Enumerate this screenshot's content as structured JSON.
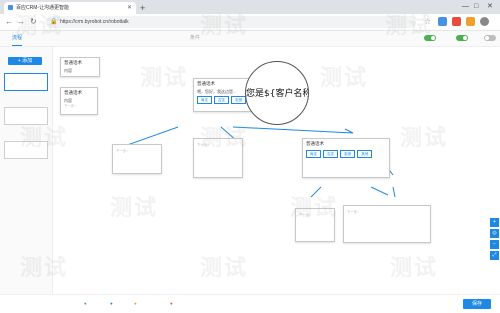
{
  "browser": {
    "tab_title": "百应CRM-让沟通更智能",
    "new_tab_label": "+",
    "url": "https://crm.byrobot.cn/robottalk",
    "win_minimize": "—",
    "win_maximize": "□",
    "win_close": "✕"
  },
  "app": {
    "top_tabs": [
      {
        "label": "流程"
      },
      {
        "label": ""
      },
      {
        "label": ""
      },
      {
        "label": ""
      },
      {
        "label": ""
      },
      {
        "label": ""
      },
      {
        "label": ""
      },
      {
        "label": "条件"
      },
      {
        "label": ""
      }
    ],
    "toggles": [
      {
        "label": "",
        "on": true
      },
      {
        "label": "",
        "on": true
      },
      {
        "label": "",
        "on": false
      }
    ],
    "add_flow_label": "+ 添加",
    "flows": [
      {
        "label": "",
        "active": true
      },
      {
        "label": "",
        "active": false
      },
      {
        "label": "",
        "active": false
      }
    ]
  },
  "canvas": {
    "magnifier_text": "您是${客户名称}吗",
    "nodes": {
      "start": {
        "title": "普通话术",
        "sub": "内容"
      },
      "left_top": {
        "title": "普通话术",
        "body": "内容",
        "branch": "下一步："
      },
      "center_top": {
        "title": "普通话术",
        "body": "喂，您好，我这边是...",
        "chips": [
          "肯定",
          "否定",
          "拒绝"
        ]
      },
      "a1": {
        "title": "",
        "body": "",
        "next": "下一步："
      },
      "a2": {
        "title": "",
        "body": "",
        "next": "下一步："
      },
      "a3": {
        "title": "普通话术",
        "body": "",
        "chips": [
          "肯定",
          "否定",
          "拒绝",
          "其他"
        ]
      },
      "b1": {
        "title": "",
        "body": "",
        "next": "下一步："
      },
      "b2": {
        "title": "",
        "body": "",
        "next": "下一步："
      }
    }
  },
  "footer": {
    "legend": [
      {
        "icon": "circle-icon",
        "label": ""
      },
      {
        "icon": "circle-icon",
        "label": ""
      },
      {
        "icon": "circle-icon",
        "label": ""
      },
      {
        "icon": "circle-icon",
        "label": ""
      }
    ],
    "save_label": "保存"
  },
  "watermark": "测试",
  "colors": {
    "accent": "#1e88e5",
    "toggle_on": "#4caf50",
    "toggle_off": "#bdbdbd",
    "connector": "#1e88e5"
  }
}
